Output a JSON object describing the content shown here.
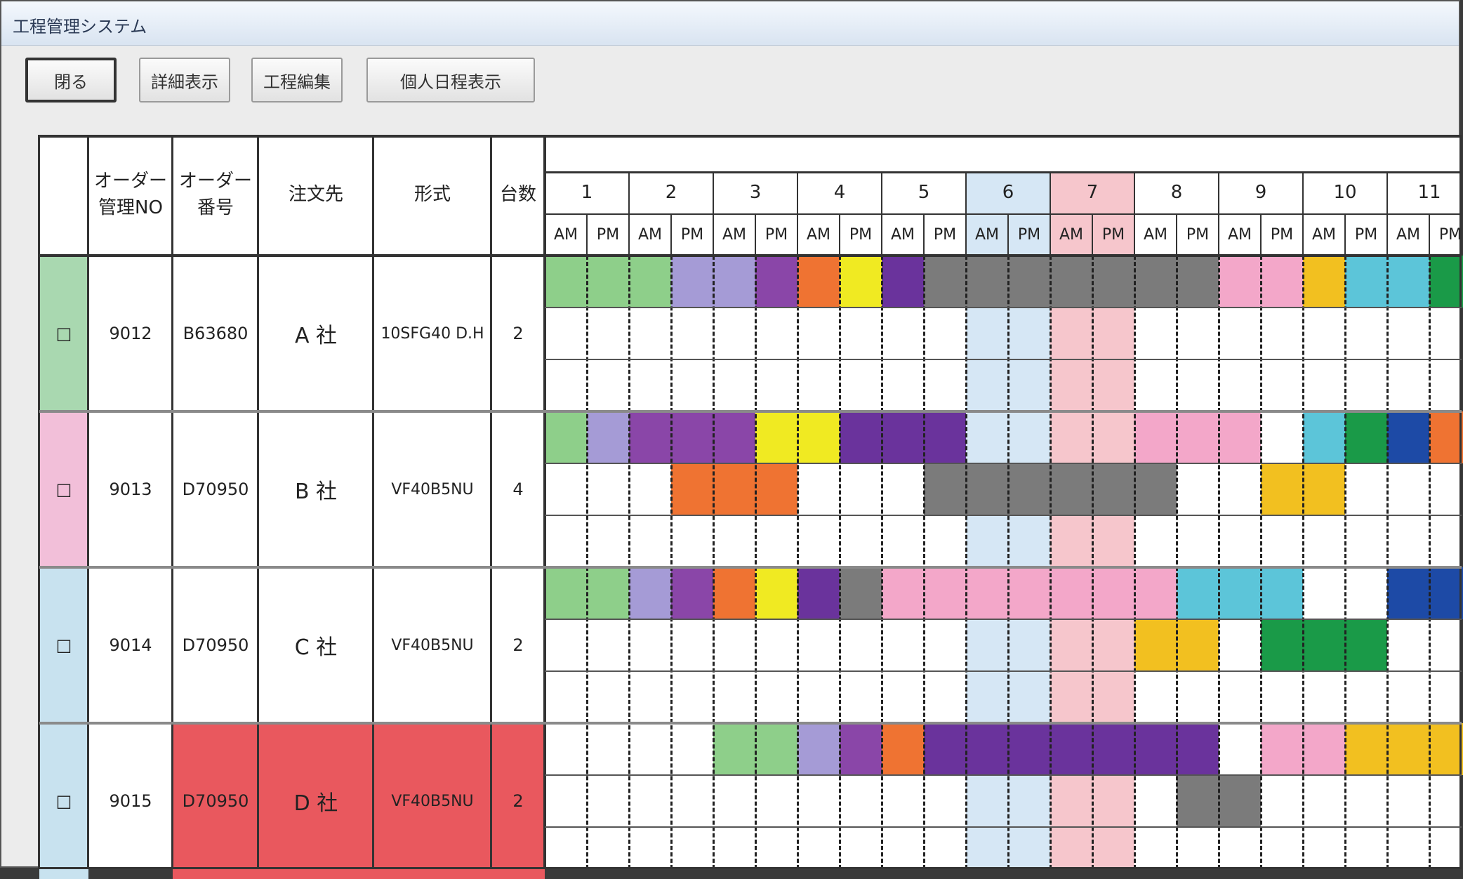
{
  "window": {
    "title": "工程管理システム"
  },
  "toolbar": {
    "buttons": [
      {
        "label": "閉る",
        "primary": true
      },
      {
        "label": "詳細表示",
        "primary": false
      },
      {
        "label": "工程編集",
        "primary": false
      },
      {
        "label": "個人日程表示",
        "primary": false
      }
    ]
  },
  "table": {
    "headers": {
      "check": "",
      "order_mgmt_no": "オーダー\n管理NO",
      "order_no": "オーダー\n番号",
      "customer": "注文先",
      "model": "形式",
      "units": "台数"
    },
    "days": [
      "1",
      "2",
      "3",
      "4",
      "5",
      "6",
      "7",
      "8",
      "9",
      "10",
      "11"
    ],
    "half_labels": [
      "AM",
      "PM"
    ],
    "day_highlights": {
      "6": "#d6e7f5",
      "7": "#f6c6cc"
    },
    "rows": [
      {
        "check": "□",
        "order_mgmt_no": "9012",
        "order_no": "B63680",
        "customer": "A 社",
        "model": "10SFG40 D.H",
        "units": "2",
        "color": "#a9d8b0",
        "highlight": ""
      },
      {
        "check": "□",
        "order_mgmt_no": "9013",
        "order_no": "D70950",
        "customer": "B 社",
        "model": "VF40B5NU",
        "units": "4",
        "color": "#f2bfd9",
        "highlight": ""
      },
      {
        "check": "□",
        "order_mgmt_no": "9014",
        "order_no": "D70950",
        "customer": "C 社",
        "model": "VF40B5NU",
        "units": "2",
        "color": "#c8e2ef",
        "highlight": ""
      },
      {
        "check": "□",
        "order_mgmt_no": "9015",
        "order_no": "D70950",
        "customer": "D 社",
        "model": "VF40B5NU",
        "units": "2",
        "color": "#c8e2ef",
        "highlight": "#e9585e"
      }
    ]
  },
  "schedule": {
    "palette": {
      "lgreen": "#8ecf8a",
      "lav": "#a59bd6",
      "purple": "#8a46a8",
      "orange": "#ef7332",
      "yellow": "#f0ea22",
      "dpurple": "#6a339c",
      "gray": "#7b7b7b",
      "pink": "#f3a7c9",
      "gold": "#f2c020",
      "cyan": "#5cc5d9",
      "green": "#1a9a48",
      "navy": "#1d4aa6"
    },
    "bars": [
      {
        "row": 0,
        "lane": 0,
        "start": 0,
        "end": 2,
        "color": "lgreen"
      },
      {
        "row": 0,
        "lane": 0,
        "start": 2,
        "end": 3,
        "color": "lgreen"
      },
      {
        "row": 0,
        "lane": 0,
        "start": 3,
        "end": 5,
        "color": "lav"
      },
      {
        "row": 0,
        "lane": 0,
        "start": 5,
        "end": 6,
        "color": "purple"
      },
      {
        "row": 0,
        "lane": 0,
        "start": 6,
        "end": 7,
        "color": "orange"
      },
      {
        "row": 0,
        "lane": 0,
        "start": 7,
        "end": 8,
        "color": "yellow"
      },
      {
        "row": 0,
        "lane": 0,
        "start": 8,
        "end": 9,
        "color": "dpurple"
      },
      {
        "row": 0,
        "lane": 0,
        "start": 9,
        "end": 16,
        "color": "gray"
      },
      {
        "row": 0,
        "lane": 0,
        "start": 16,
        "end": 18,
        "color": "pink"
      },
      {
        "row": 0,
        "lane": 0,
        "start": 18,
        "end": 19,
        "color": "gold"
      },
      {
        "row": 0,
        "lane": 0,
        "start": 19,
        "end": 21,
        "color": "cyan"
      },
      {
        "row": 0,
        "lane": 0,
        "start": 21,
        "end": 22,
        "color": "green"
      },
      {
        "row": 1,
        "lane": 0,
        "start": 0,
        "end": 1,
        "color": "lgreen"
      },
      {
        "row": 1,
        "lane": 0,
        "start": 1,
        "end": 2,
        "color": "lav"
      },
      {
        "row": 1,
        "lane": 0,
        "start": 2,
        "end": 5,
        "color": "purple"
      },
      {
        "row": 1,
        "lane": 0,
        "start": 5,
        "end": 7,
        "color": "yellow"
      },
      {
        "row": 1,
        "lane": 0,
        "start": 7,
        "end": 10,
        "color": "dpurple"
      },
      {
        "row": 1,
        "lane": 0,
        "start": 14,
        "end": 17,
        "color": "pink"
      },
      {
        "row": 1,
        "lane": 0,
        "start": 18,
        "end": 19,
        "color": "cyan"
      },
      {
        "row": 1,
        "lane": 0,
        "start": 19,
        "end": 20,
        "color": "green"
      },
      {
        "row": 1,
        "lane": 0,
        "start": 20,
        "end": 21,
        "color": "navy"
      },
      {
        "row": 1,
        "lane": 0,
        "start": 21,
        "end": 22,
        "color": "orange"
      },
      {
        "row": 1,
        "lane": 1,
        "start": 3,
        "end": 6,
        "color": "orange"
      },
      {
        "row": 1,
        "lane": 1,
        "start": 9,
        "end": 15,
        "color": "gray"
      },
      {
        "row": 1,
        "lane": 1,
        "start": 17,
        "end": 19,
        "color": "gold"
      },
      {
        "row": 2,
        "lane": 0,
        "start": 0,
        "end": 2,
        "color": "lgreen"
      },
      {
        "row": 2,
        "lane": 0,
        "start": 2,
        "end": 3,
        "color": "lav"
      },
      {
        "row": 2,
        "lane": 0,
        "start": 3,
        "end": 4,
        "color": "purple"
      },
      {
        "row": 2,
        "lane": 0,
        "start": 4,
        "end": 5,
        "color": "orange"
      },
      {
        "row": 2,
        "lane": 0,
        "start": 5,
        "end": 6,
        "color": "yellow"
      },
      {
        "row": 2,
        "lane": 0,
        "start": 6,
        "end": 7,
        "color": "dpurple"
      },
      {
        "row": 2,
        "lane": 0,
        "start": 7,
        "end": 8,
        "color": "gray"
      },
      {
        "row": 2,
        "lane": 0,
        "start": 8,
        "end": 15,
        "color": "pink"
      },
      {
        "row": 2,
        "lane": 0,
        "start": 15,
        "end": 18,
        "color": "cyan"
      },
      {
        "row": 2,
        "lane": 0,
        "start": 20,
        "end": 22,
        "color": "navy"
      },
      {
        "row": 2,
        "lane": 1,
        "start": 14,
        "end": 16,
        "color": "gold"
      },
      {
        "row": 2,
        "lane": 1,
        "start": 17,
        "end": 20,
        "color": "green"
      },
      {
        "row": 3,
        "lane": 0,
        "start": 4,
        "end": 6,
        "color": "lgreen"
      },
      {
        "row": 3,
        "lane": 0,
        "start": 6,
        "end": 7,
        "color": "lav"
      },
      {
        "row": 3,
        "lane": 0,
        "start": 7,
        "end": 8,
        "color": "purple"
      },
      {
        "row": 3,
        "lane": 0,
        "start": 8,
        "end": 9,
        "color": "orange"
      },
      {
        "row": 3,
        "lane": 0,
        "start": 9,
        "end": 16,
        "color": "dpurple"
      },
      {
        "row": 3,
        "lane": 0,
        "start": 17,
        "end": 19,
        "color": "pink"
      },
      {
        "row": 3,
        "lane": 0,
        "start": 19,
        "end": 22,
        "color": "gold"
      },
      {
        "row": 3,
        "lane": 1,
        "start": 15,
        "end": 17,
        "color": "gray"
      }
    ]
  }
}
